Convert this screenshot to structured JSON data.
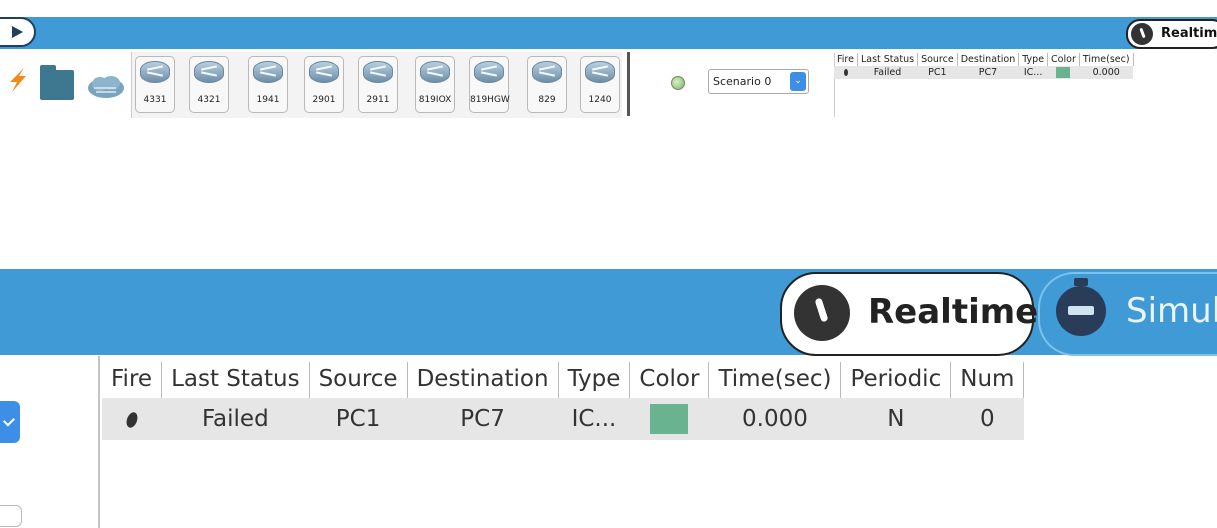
{
  "top": {
    "mode_label": "Realtim",
    "devices": [
      "4331",
      "4321",
      "1941",
      "2901",
      "2911",
      "819IOX",
      "819HGW",
      "829",
      "1240"
    ],
    "scenario": "Scenario 0",
    "pdu_table": {
      "headers": [
        "Fire",
        "Last Status",
        "Source",
        "Destination",
        "Type",
        "Color",
        "Time(sec)"
      ],
      "row": {
        "last_status": "Failed",
        "source": "PC1",
        "destination": "PC7",
        "type": "IC...",
        "time": "0.000"
      }
    }
  },
  "zoomed": {
    "realtime_label": "Realtime",
    "simulation_label": "Simul",
    "pdu_table": {
      "headers": [
        "Fire",
        "Last Status",
        "Source",
        "Destination",
        "Type",
        "Color",
        "Time(sec)",
        "Periodic",
        "Num"
      ],
      "row": {
        "last_status": "Failed",
        "source": "PC1",
        "destination": "PC7",
        "type": "IC...",
        "time": "0.000",
        "periodic": "N",
        "num": "0"
      }
    }
  },
  "colors": {
    "toolbar": "#3f9ad6",
    "pdu_swatch": "#69b391",
    "select_button": "#3d8ee6"
  },
  "icons": [
    "play-icon",
    "clock-icon",
    "lightning-icon",
    "folder-icon",
    "cloud-icon",
    "router-icon",
    "scenario-info-icon",
    "chevron-down-icon",
    "stopwatch-icon",
    "checkmark-icon"
  ]
}
